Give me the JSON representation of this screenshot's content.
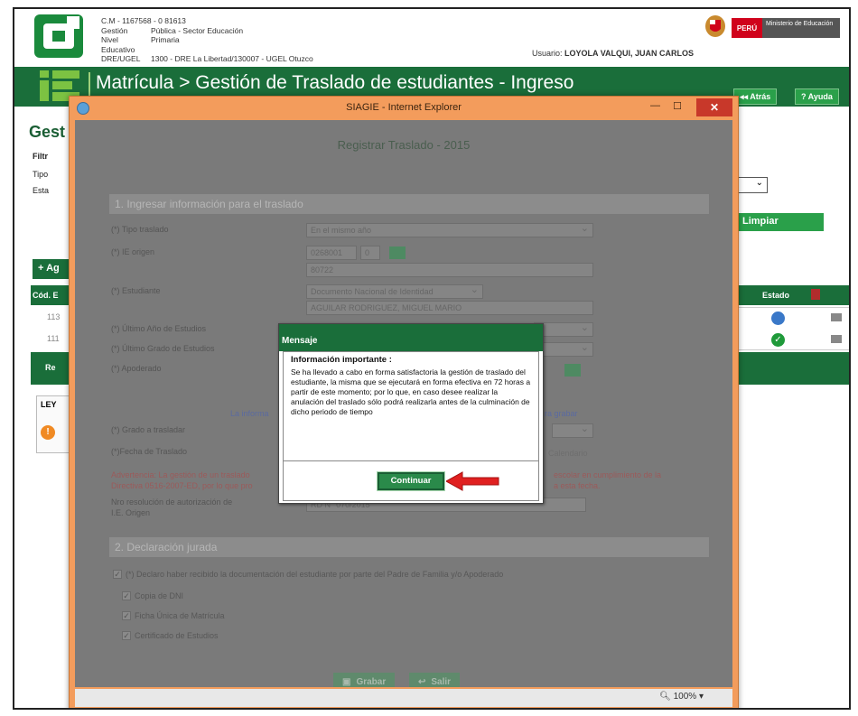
{
  "header": {
    "line1_code": "C.M - 1167568 - 0  81613",
    "gestion_label": "Gestión",
    "gestion_value": "Pública - Sector Educación",
    "nivel_label": "Nivel Educativo",
    "nivel_value": "Primaria",
    "dre_label": "DRE/UGEL",
    "dre_value": "1300 - DRE La Libertad/130007 - UGEL Otuzco",
    "usuario_label": "Usuario:",
    "usuario_value": "LOYOLA VALQUI, JUAN CARLOS",
    "peru": "PERÚ",
    "ministerio": "Ministerio de Educación"
  },
  "titlebar": {
    "title": "Matrícula > Gestión de Traslado de estudiantes - Ingreso",
    "atras": "◂◂ Atrás",
    "ayuda": "? Ayuda"
  },
  "background": {
    "gest": "Gest",
    "filtro": "Filtr",
    "tipo": "Tipo",
    "estado": "Esta",
    "limpiar": "Limpiar",
    "agregar": "+ Ag",
    "col_cod": "Cód. E",
    "col_p": "o",
    "col_estado": "Estado",
    "row1": "113",
    "row2": "111",
    "re": "Re",
    "ley": "LEY"
  },
  "ie_window": {
    "title": "SIAGIE - Internet Explorer",
    "zoom": "100%"
  },
  "form": {
    "title": "Registrar Traslado - 2015",
    "section1": "1. Ingresar información para el traslado",
    "tipo_traslado_label": "(*) Tipo traslado",
    "tipo_traslado_value": "En el mismo año",
    "ie_origen_label": "(*) IE origen",
    "ie_origen_code": "0268001",
    "ie_origen_anexo": "0",
    "ie_origen_name": "80722",
    "estudiante_label": "(*) Estudiante",
    "estudiante_doc": "Documento Nacional de Identidad",
    "estudiante_name": "AGUILAR RODRIGUEZ, MIGUEL MARIO",
    "ultimo_anio_label": "(*) Último Año de Estudios",
    "ultimo_grado_label": "(*) Último Grado de Estudios",
    "apoderado_label": "(*) Apoderado",
    "info_left": "La informa",
    "info_right": "ra grabar",
    "grado_label": "(*) Grado a trasladar",
    "fecha_label": "(*)Fecha de Traslado",
    "calendario": "Calendario",
    "warning_left": "Advertencia: La gestión de un traslado",
    "warning_right": "escolar en cumplimiento de la",
    "warning_left2": "Directiva 0516-2007-ED, por lo que pro",
    "warning_right2": "a esta fecha.",
    "resolucion_label": "Nro resolución de autorización de",
    "resolucion_label2": "I.E. Origen",
    "resolucion_value": "RD N° 070/2015",
    "section2": "2. Declaración jurada",
    "declaro": "(*) Declaro haber recibido la documentación del estudiante por parte del Padre de Familia y/o Apoderado",
    "doc1": "Copia de DNI",
    "doc2": "Ficha Única de Matrícula",
    "doc3": "Certificado de Estudios",
    "grabar": "Grabar",
    "salir": "Salir"
  },
  "mensaje": {
    "header": "Mensaje",
    "title": "Información importante :",
    "body": "Se ha llevado a cabo en forma satisfactoria la gestión de traslado del estudiante, la misma que se ejecutará en forma efectiva en 72 horas a partir de este momento; por lo que, en caso desee realizar la anulación del traslado sólo podrá realizarla antes de la culminación de dicho periodo de tiempo",
    "button": "Continuar"
  },
  "colors": {
    "brand_green": "#1a6e3a",
    "button_green": "#2aa04a",
    "ie_frame": "#f39c5c",
    "arrow_red": "#e02020"
  }
}
